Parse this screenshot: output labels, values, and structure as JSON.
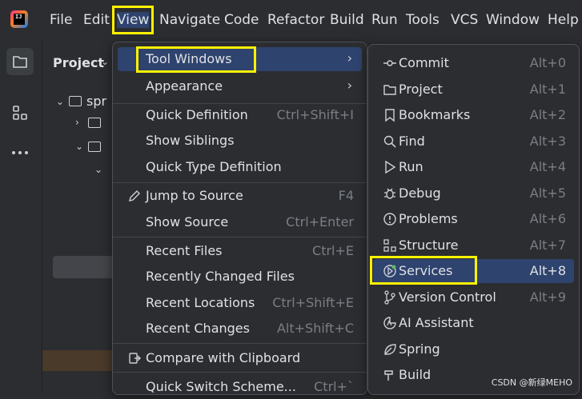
{
  "menubar": {
    "items": [
      "File",
      "Edit",
      "View",
      "Navigate",
      "Code",
      "Refactor",
      "Build",
      "Run",
      "Tools",
      "VCS",
      "Window",
      "Help"
    ]
  },
  "project": {
    "title": "Project",
    "chevron": "chevron-down-icon",
    "tree": [
      "spr"
    ]
  },
  "view_menu": {
    "items": [
      {
        "label": "Tool Windows",
        "shortcut": "",
        "submenu": true
      },
      {
        "label": "Appearance",
        "shortcut": "",
        "submenu": true
      },
      {
        "label": "Quick Definition",
        "shortcut": "Ctrl+Shift+I"
      },
      {
        "label": "Show Siblings",
        "shortcut": ""
      },
      {
        "label": "Quick Type Definition",
        "shortcut": ""
      },
      {
        "label": "Jump to Source",
        "shortcut": "F4",
        "icon": "pencil-icon"
      },
      {
        "label": "Show Source",
        "shortcut": "Ctrl+Enter"
      },
      {
        "label": "Recent Files",
        "shortcut": "Ctrl+E"
      },
      {
        "label": "Recently Changed Files",
        "shortcut": ""
      },
      {
        "label": "Recent Locations",
        "shortcut": "Ctrl+Shift+E"
      },
      {
        "label": "Recent Changes",
        "shortcut": "Alt+Shift+C"
      },
      {
        "label": "Compare with Clipboard",
        "shortcut": "",
        "icon": "clipboard-compare-icon"
      },
      {
        "label": "Quick Switch Scheme...",
        "shortcut": "Ctrl+`"
      }
    ]
  },
  "tool_windows_menu": {
    "items": [
      {
        "label": "Commit",
        "shortcut": "Alt+0",
        "icon": "commit-icon"
      },
      {
        "label": "Project",
        "shortcut": "Alt+1",
        "icon": "folder-icon"
      },
      {
        "label": "Bookmarks",
        "shortcut": "Alt+2",
        "icon": "bookmark-icon"
      },
      {
        "label": "Find",
        "shortcut": "Alt+3",
        "icon": "search-icon"
      },
      {
        "label": "Run",
        "shortcut": "Alt+4",
        "icon": "play-icon"
      },
      {
        "label": "Debug",
        "shortcut": "Alt+5",
        "icon": "bug-icon"
      },
      {
        "label": "Problems",
        "shortcut": "Alt+6",
        "icon": "warning-icon"
      },
      {
        "label": "Structure",
        "shortcut": "Alt+7",
        "icon": "structure-icon"
      },
      {
        "label": "Services",
        "shortcut": "Alt+8",
        "icon": "services-icon"
      },
      {
        "label": "Version Control",
        "shortcut": "Alt+9",
        "icon": "branch-icon"
      },
      {
        "label": "AI Assistant",
        "shortcut": "",
        "icon": "ai-icon"
      },
      {
        "label": "Spring",
        "shortcut": "",
        "icon": "leaf-icon"
      },
      {
        "label": "Build",
        "shortcut": "",
        "icon": "hammer-icon"
      }
    ]
  },
  "watermark": "CSDN @新绿MEHO"
}
